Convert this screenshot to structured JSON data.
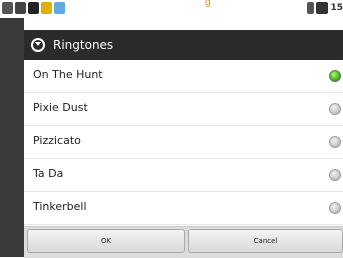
{
  "status_bar": {
    "time": "15",
    "notification_text": "g"
  },
  "dialog": {
    "title": "Ringtones",
    "items": [
      {
        "label": "On The Hunt",
        "selected": true
      },
      {
        "label": "Pixie Dust",
        "selected": false
      },
      {
        "label": "Pizzicato",
        "selected": false
      },
      {
        "label": "Ta Da",
        "selected": false
      },
      {
        "label": "Tinkerbell",
        "selected": false
      }
    ],
    "ok_label": "OK",
    "cancel_label": "Cancel"
  },
  "colors": {
    "title_bar": "#2b2b2b",
    "selected_radio": "#4fc423"
  }
}
